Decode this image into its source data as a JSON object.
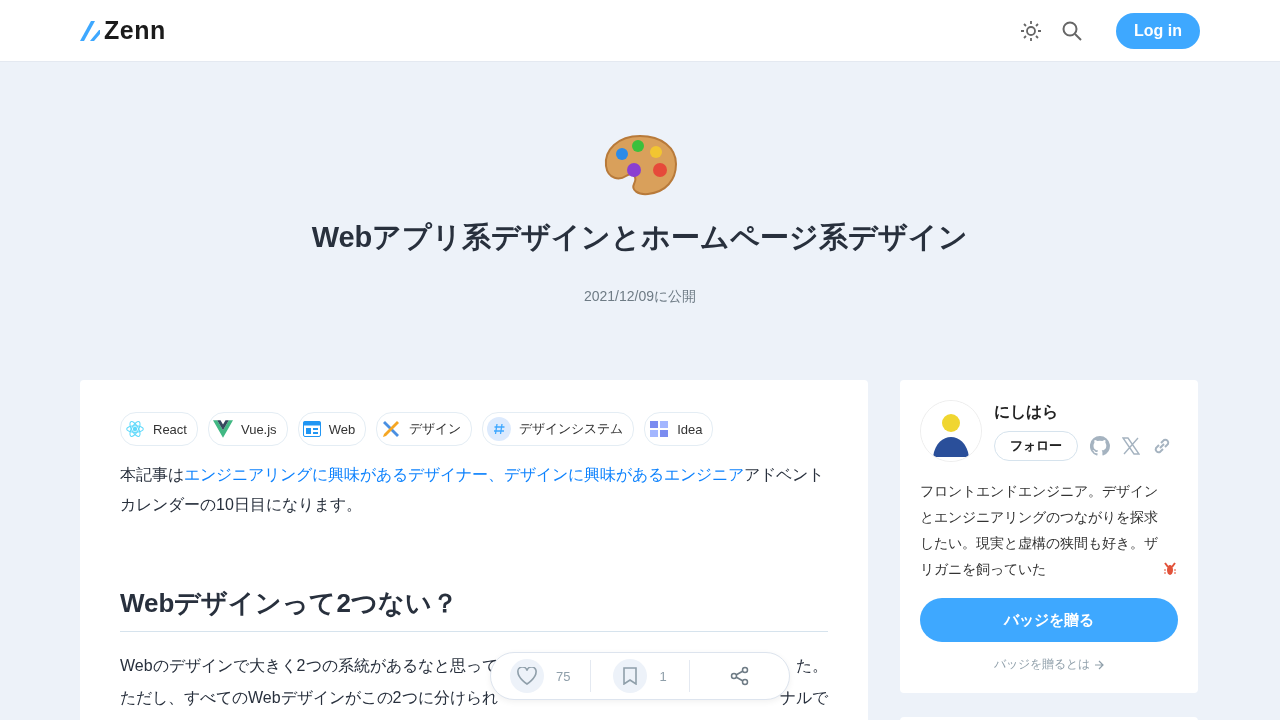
{
  "header": {
    "logo": "Zenn",
    "login": "Log in"
  },
  "article": {
    "title": "Webアプリ系デザインとホームページ系デザイン",
    "published": "2021/12/09に公開"
  },
  "tags": [
    {
      "label": "React"
    },
    {
      "label": "Vue.js"
    },
    {
      "label": "Web"
    },
    {
      "label": "デザイン"
    },
    {
      "label": "デザインシステム"
    },
    {
      "label": "Idea"
    }
  ],
  "intro": {
    "before": "本記事は",
    "link": "エンジニアリングに興味があるデザイナー、デザインに興味があるエンジニア",
    "after": "アドベントカレンダーの10日目になります。"
  },
  "heading": "Webデザインって2つない？",
  "paragraph_lines": [
    {
      "left": "Webのデザインで大きく2つの系統があるなと思って",
      "right": "た。"
    },
    {
      "left": "ただし、すべてのWebデザインがこの2つに分けられ",
      "right": "ナルで"
    }
  ],
  "action_bar": {
    "likes": "75",
    "bookmarks": "1"
  },
  "author": {
    "name": "にしはら",
    "follow": "フォロー",
    "bio": "フロントエンドエンジニア。デザインとエンジニアリングのつながりを探求したい。現実と虚構の狭間も好き。ザリガニを飼っていた",
    "badge_button": "バッジを贈る",
    "badge_link": "バッジを贈るとは"
  }
}
